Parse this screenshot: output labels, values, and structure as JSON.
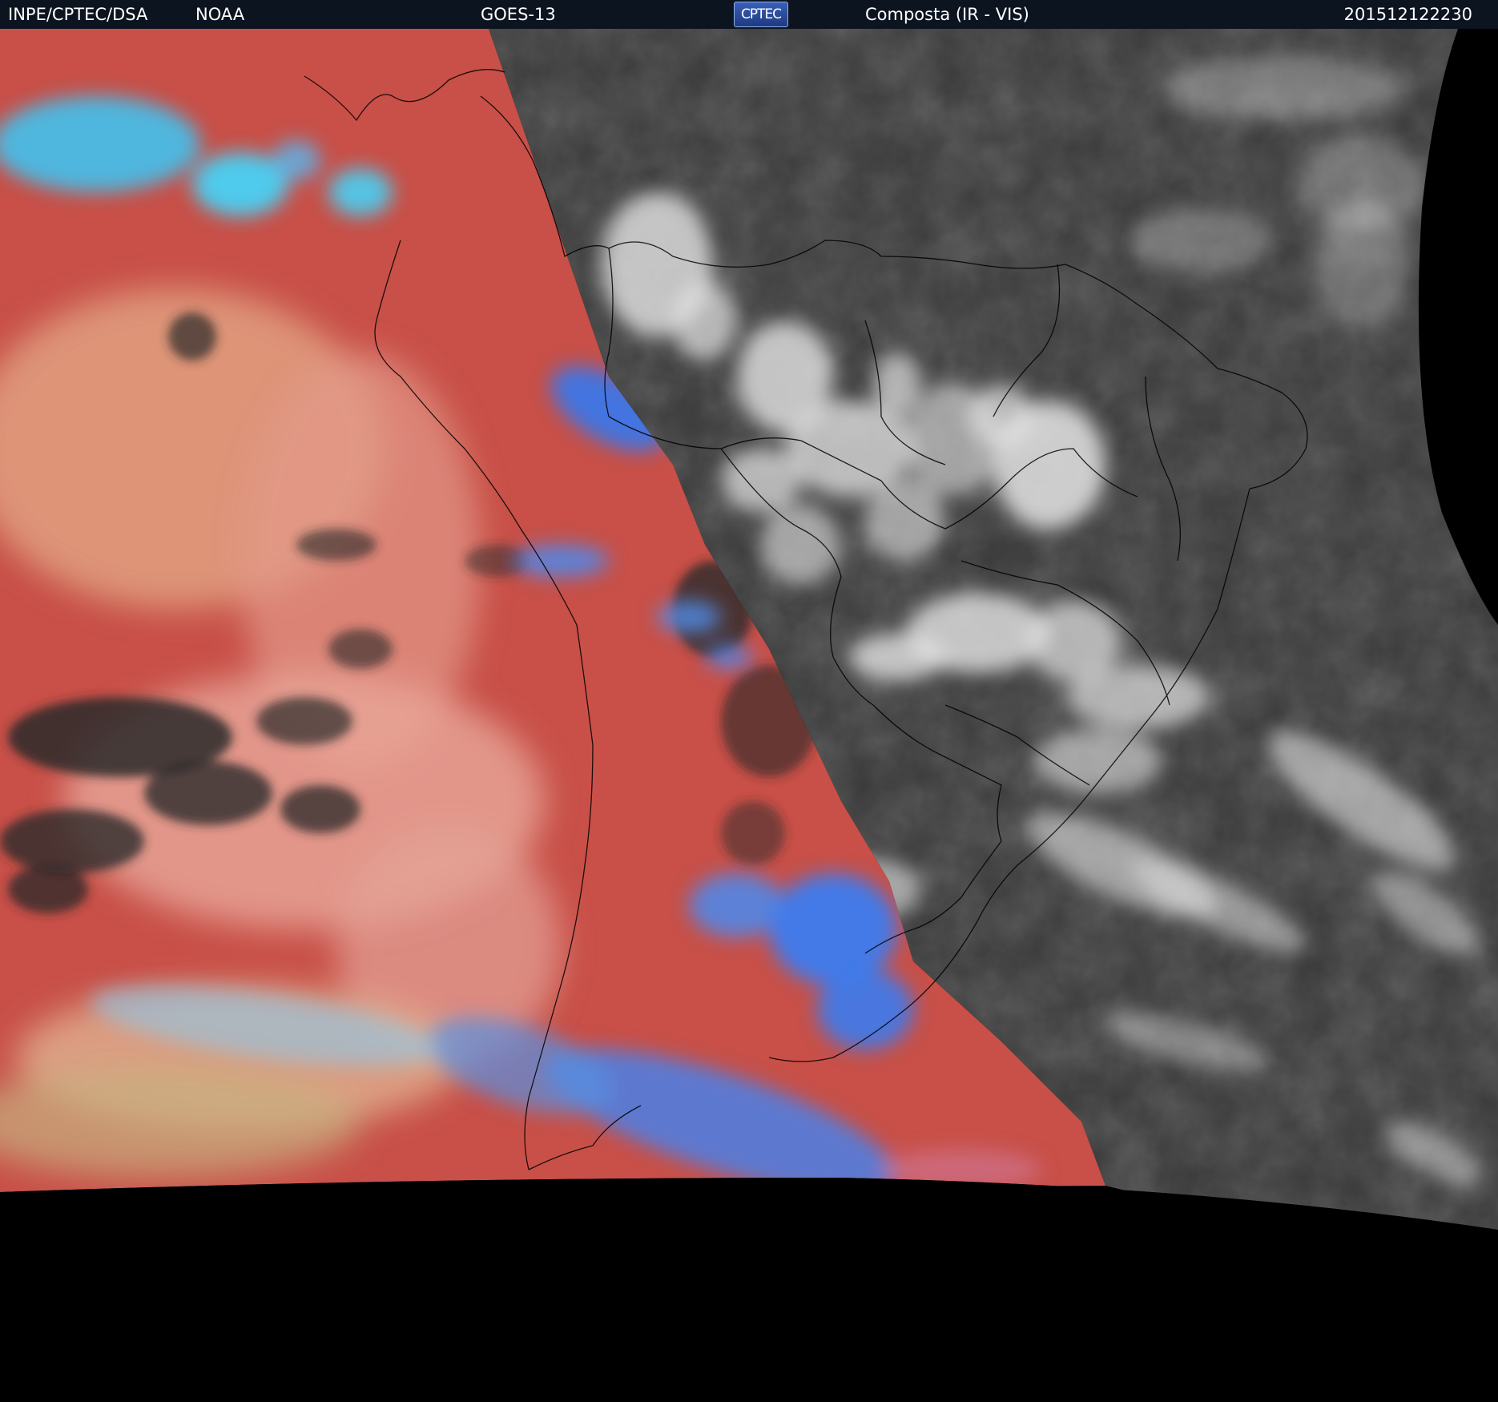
{
  "header": {
    "organization": "INPE/CPTEC/DSA",
    "agency": "NOAA",
    "satellite": "GOES-13",
    "logo_text": "CPTEC",
    "product": "Composta (IR - VIS)",
    "timestamp": "201512122230"
  },
  "colors": {
    "header_bg": "#0c1420",
    "header_text": "#ffffff",
    "ir_clear": "#c85048",
    "ir_cold_cloud": "#3c7cf0",
    "ir_very_cold": "#28d8ff",
    "ir_low_cloud": "#e8a088",
    "vis_background": "#3a3a3a",
    "vis_cloud": "#e8e8e8",
    "outside_disk": "#000000",
    "borders": "#000000"
  }
}
